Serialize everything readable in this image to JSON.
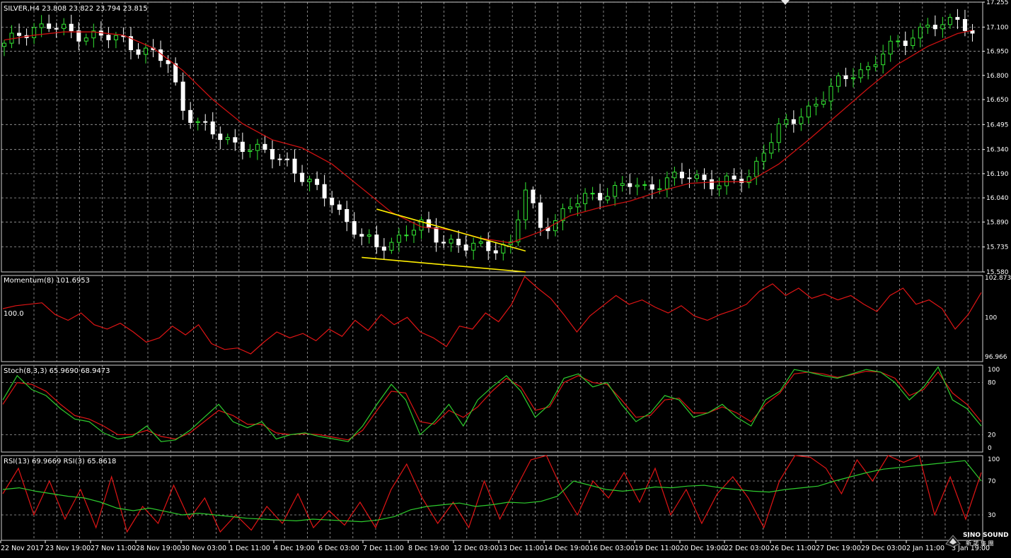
{
  "colors": {
    "background": "#000000",
    "grid": "#d8d8d8",
    "bull_candle": "#33e633",
    "bear_candle": "#ffffff",
    "moving_average": "#cc1111",
    "trendline": "#ffee00",
    "oscillator_red": "#e01515",
    "oscillator_green": "#2ecc2e",
    "text": "#ffffff"
  },
  "icons": {
    "corner_marker": "triangle-down-icon",
    "watermark_logo": "sino-sound-logo"
  },
  "watermark": {
    "line1": "SINO SOUND",
    "line2": "新 諾 集 團"
  },
  "chart_data": [
    {
      "type": "candlestick",
      "title": "SILVER,H4  23.808 23.822 23.794 23.815",
      "symbol": "SILVER,H4",
      "ohlc_header": [
        "23.808",
        "23.822",
        "23.794",
        "23.815"
      ],
      "y_ticks": [
        "17.255",
        "17.100",
        "16.950",
        "16.800",
        "16.650",
        "16.495",
        "16.340",
        "16.190",
        "16.040",
        "15.890",
        "15.735",
        "15.580"
      ],
      "ylim": [
        15.58,
        17.255
      ],
      "x_ticks": [
        "22 Nov 2017",
        "23 Nov 19:00",
        "27 Nov 11:00",
        "28 Nov 19:00",
        "30 Nov 03:00",
        "1 Dec 11:00",
        "4 Dec 19:00",
        "6 Dec 03:00",
        "7 Dec 11:00",
        "8 Dec 19:00",
        "12 Dec 03:00",
        "13 Dec 11:00",
        "14 Dec 19:00",
        "16 Dec 03:00",
        "19 Dec 11:00",
        "20 Dec 19:00",
        "22 Dec 03:00",
        "26 Dec 11:00",
        "27 Dec 19:00",
        "29 Dec 03:00",
        "2 Jan 11:00",
        "3 Jan 19:00"
      ],
      "close_path": [
        [
          0,
          16.98
        ],
        [
          2,
          17.06
        ],
        [
          4,
          17.1
        ],
        [
          6,
          17.1
        ],
        [
          8,
          17.08
        ],
        [
          10,
          17.06
        ],
        [
          12,
          17.05
        ],
        [
          14,
          17.03
        ],
        [
          16,
          17.02
        ],
        [
          18,
          16.97
        ],
        [
          20,
          16.93
        ],
        [
          22,
          16.87
        ],
        [
          24,
          16.6
        ],
        [
          26,
          16.51
        ],
        [
          28,
          16.43
        ],
        [
          30,
          16.4
        ],
        [
          32,
          16.37
        ],
        [
          34,
          16.33
        ],
        [
          36,
          16.3
        ],
        [
          38,
          16.27
        ],
        [
          40,
          16.17
        ],
        [
          42,
          16.08
        ],
        [
          44,
          16.02
        ],
        [
          46,
          15.9
        ],
        [
          48,
          15.79
        ],
        [
          50,
          15.73
        ],
        [
          52,
          15.77
        ],
        [
          54,
          15.83
        ],
        [
          56,
          15.86
        ],
        [
          58,
          15.8
        ],
        [
          60,
          15.77
        ],
        [
          62,
          15.73
        ],
        [
          64,
          15.73
        ],
        [
          66,
          15.74
        ],
        [
          68,
          15.75
        ],
        [
          70,
          16.08
        ],
        [
          72,
          15.86
        ],
        [
          74,
          15.91
        ],
        [
          76,
          15.98
        ],
        [
          78,
          16.04
        ],
        [
          80,
          16.07
        ],
        [
          82,
          16.09
        ],
        [
          84,
          16.12
        ],
        [
          86,
          16.1
        ],
        [
          88,
          16.14
        ],
        [
          90,
          16.16
        ],
        [
          92,
          16.17
        ],
        [
          94,
          16.16
        ],
        [
          96,
          16.12
        ],
        [
          98,
          16.14
        ],
        [
          100,
          16.17
        ],
        [
          102,
          16.35
        ],
        [
          104,
          16.46
        ],
        [
          106,
          16.52
        ],
        [
          108,
          16.6
        ],
        [
          110,
          16.67
        ],
        [
          112,
          16.75
        ],
        [
          114,
          16.82
        ],
        [
          116,
          16.85
        ],
        [
          118,
          16.93
        ],
        [
          120,
          17.0
        ],
        [
          122,
          17.05
        ],
        [
          124,
          17.12
        ],
        [
          126,
          17.08
        ],
        [
          128,
          17.18
        ],
        [
          130,
          17.05
        ]
      ],
      "moving_average_path": [
        [
          0,
          17.02
        ],
        [
          4,
          17.05
        ],
        [
          8,
          17.07
        ],
        [
          12,
          17.07
        ],
        [
          16,
          17.05
        ],
        [
          20,
          16.97
        ],
        [
          24,
          16.83
        ],
        [
          28,
          16.65
        ],
        [
          32,
          16.5
        ],
        [
          36,
          16.4
        ],
        [
          40,
          16.35
        ],
        [
          44,
          16.25
        ],
        [
          48,
          16.1
        ],
        [
          52,
          15.95
        ],
        [
          56,
          15.86
        ],
        [
          60,
          15.84
        ],
        [
          64,
          15.79
        ],
        [
          68,
          15.76
        ],
        [
          72,
          15.83
        ],
        [
          76,
          15.93
        ],
        [
          80,
          15.98
        ],
        [
          84,
          16.02
        ],
        [
          88,
          16.08
        ],
        [
          92,
          16.13
        ],
        [
          96,
          16.14
        ],
        [
          100,
          16.14
        ],
        [
          104,
          16.25
        ],
        [
          108,
          16.4
        ],
        [
          112,
          16.56
        ],
        [
          116,
          16.72
        ],
        [
          120,
          16.87
        ],
        [
          124,
          16.98
        ],
        [
          128,
          17.06
        ],
        [
          130,
          17.08
        ]
      ],
      "trendlines": [
        {
          "from": [
            50,
            15.97
          ],
          "to": [
            70,
            15.71
          ]
        },
        {
          "from": [
            48,
            15.67
          ],
          "to": [
            70,
            15.58
          ]
        }
      ]
    },
    {
      "type": "line",
      "title": "Momentum(8) 101.6953",
      "y_ticks": [
        "102.8735",
        "100",
        "96.966"
      ],
      "ylim": [
        96.966,
        102.8735
      ],
      "level_label": "100.0",
      "series": [
        {
          "name": "Momentum(8)",
          "values": [
            100.6,
            100.8,
            100.9,
            101.0,
            100.2,
            99.8,
            100.3,
            99.5,
            99.2,
            99.6,
            99.0,
            98.3,
            98.6,
            99.4,
            98.8,
            99.5,
            98.2,
            97.8,
            97.9,
            97.5,
            98.3,
            99.0,
            98.6,
            98.9,
            98.4,
            99.2,
            98.7,
            99.8,
            99.1,
            100.2,
            99.5,
            100.0,
            99.0,
            98.6,
            98.0,
            99.4,
            99.2,
            100.3,
            99.7,
            100.9,
            102.8,
            102.0,
            101.3,
            100.2,
            99.0,
            100.1,
            100.8,
            101.5,
            100.9,
            101.2,
            100.7,
            100.3,
            100.8,
            100.1,
            99.8,
            100.2,
            100.5,
            100.9,
            101.8,
            102.3,
            101.5,
            102.0,
            101.3,
            101.6,
            101.2,
            101.5,
            100.9,
            100.4,
            101.5,
            102.0,
            100.9,
            101.2,
            100.6,
            99.2,
            100.2,
            101.7
          ]
        }
      ]
    },
    {
      "type": "line",
      "title": "Stoch(8,3,3) 65.9690 68.9473",
      "y_ticks": [
        "100",
        "80",
        "20",
        "0"
      ],
      "ylim": [
        0,
        100
      ],
      "series": [
        {
          "name": "Stoch %K",
          "values": [
            60,
            88,
            72,
            65,
            50,
            38,
            35,
            22,
            15,
            18,
            30,
            12,
            14,
            25,
            40,
            55,
            35,
            28,
            35,
            15,
            20,
            22,
            18,
            15,
            12,
            30,
            55,
            78,
            60,
            20,
            35,
            55,
            30,
            60,
            75,
            88,
            70,
            40,
            55,
            85,
            90,
            75,
            80,
            55,
            35,
            45,
            65,
            60,
            40,
            45,
            55,
            40,
            30,
            60,
            70,
            95,
            92,
            88,
            85,
            90,
            95,
            92,
            80,
            60,
            75,
            98,
            60,
            50,
            30
          ]
        },
        {
          "name": "Stoch %D",
          "values": [
            55,
            80,
            78,
            70,
            55,
            42,
            38,
            30,
            20,
            20,
            25,
            18,
            15,
            22,
            35,
            48,
            42,
            32,
            32,
            22,
            20,
            21,
            20,
            17,
            14,
            25,
            48,
            70,
            68,
            35,
            32,
            48,
            40,
            52,
            70,
            85,
            75,
            48,
            52,
            80,
            88,
            80,
            78,
            60,
            40,
            42,
            60,
            62,
            45,
            45,
            52,
            45,
            35,
            55,
            68,
            90,
            92,
            90,
            86,
            89,
            93,
            92,
            85,
            65,
            72,
            92,
            68,
            55,
            35
          ]
        }
      ]
    },
    {
      "type": "line",
      "title": "RSI(13) 69.9669  RSI(3) 65.8618",
      "y_ticks": [
        "100",
        "70",
        "30"
      ],
      "ylim": [
        0,
        100
      ],
      "series": [
        {
          "name": "RSI(13)",
          "values": [
            60,
            62,
            58,
            55,
            52,
            50,
            45,
            38,
            35,
            38,
            34,
            30,
            32,
            30,
            28,
            26,
            25,
            24,
            23,
            25,
            24,
            23,
            22,
            24,
            28,
            36,
            40,
            42,
            44,
            40,
            42,
            45,
            44,
            46,
            52,
            70,
            65,
            60,
            58,
            60,
            63,
            62,
            64,
            65,
            62,
            60,
            58,
            57,
            60,
            62,
            64,
            70,
            75,
            80,
            84,
            86,
            88,
            90,
            92,
            94,
            70
          ]
        },
        {
          "name": "RSI(3)",
          "values": [
            55,
            85,
            30,
            70,
            25,
            60,
            15,
            75,
            10,
            40,
            20,
            65,
            25,
            50,
            10,
            30,
            12,
            40,
            20,
            55,
            15,
            35,
            18,
            45,
            15,
            60,
            90,
            50,
            20,
            45,
            15,
            70,
            25,
            60,
            95,
            100,
            60,
            30,
            70,
            50,
            80,
            45,
            85,
            30,
            60,
            20,
            55,
            75,
            50,
            15,
            70,
            100,
            98,
            85,
            55,
            95,
            70,
            100,
            92,
            100,
            30,
            75,
            25,
            80
          ]
        }
      ]
    }
  ]
}
